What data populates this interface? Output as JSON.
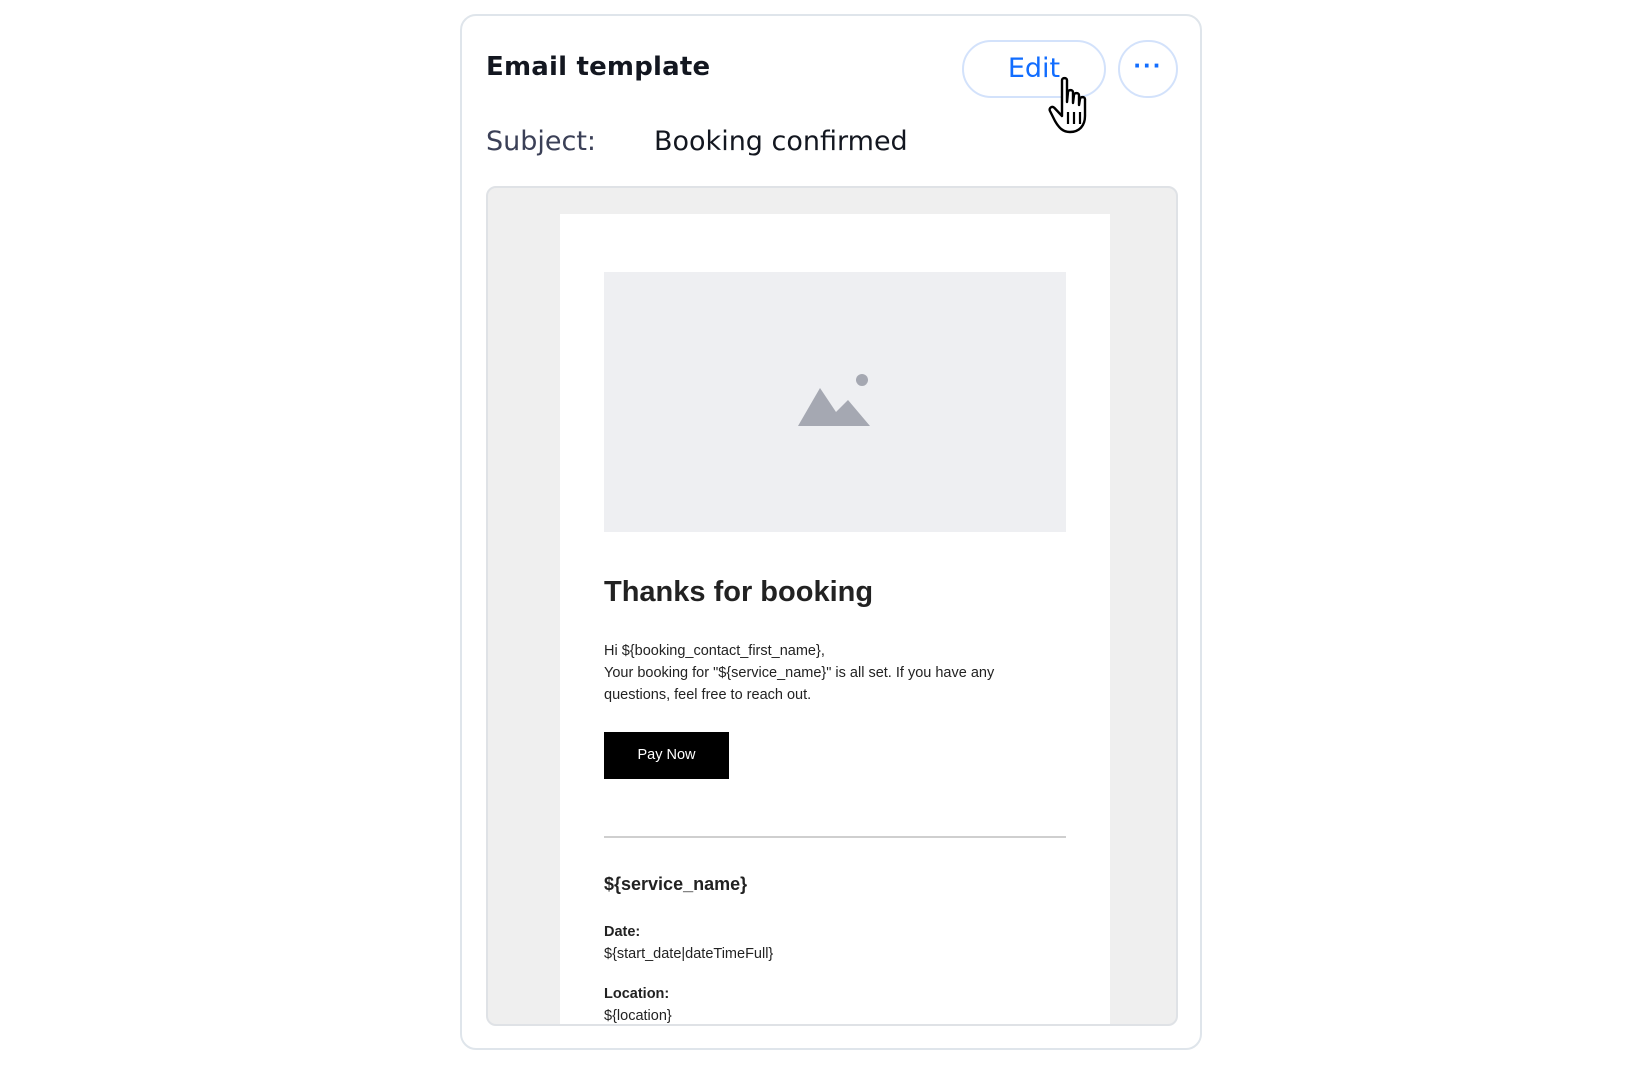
{
  "card": {
    "title": "Email template",
    "edit_label": "Edit",
    "more_label": "···",
    "subject_label": "Subject:",
    "subject_value": "Booking confirmed"
  },
  "email": {
    "image_placeholder_icon": "image-placeholder-icon",
    "heading": "Thanks for booking",
    "body_lines": [
      "Hi ${booking_contact_first_name},",
      "Your booking for \"${service_name}\" is all set. If you have any",
      "questions, feel free to reach out."
    ],
    "pay_button_label": "Pay Now",
    "service_heading": "${service_name}",
    "details": [
      {
        "label": "Date:",
        "value": "${start_date|dateTimeFull}"
      },
      {
        "label": "Location:",
        "value": "${location}"
      }
    ]
  },
  "colors": {
    "accent": "#116dff",
    "card_border": "#dfe5eb",
    "preview_background": "#efefef",
    "image_placeholder": "#eeeff2",
    "pay_button": "#000000"
  },
  "cursor_icon": "hand-pointer-icon"
}
